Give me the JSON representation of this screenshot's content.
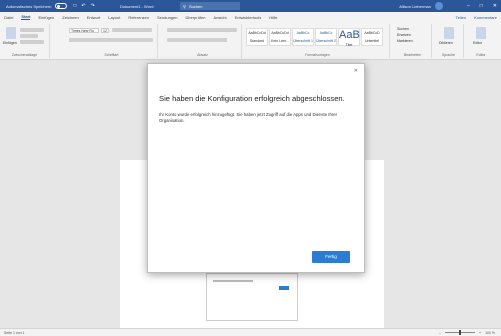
{
  "titlebar": {
    "autosave_label": "Automatisches Speichern",
    "autosave_state": "Aus",
    "doc_title": "Dokument1 - Word",
    "search_placeholder": "Suchen",
    "user_name": "Allison Lieberman"
  },
  "ribbon": {
    "tabs": [
      "Datei",
      "Start",
      "Einfügen",
      "Zeichnen",
      "Entwurf",
      "Layout",
      "Referenzen",
      "Sendungen",
      "Überprüfen",
      "Ansicht",
      "Entwicklertools",
      "Hilfe"
    ],
    "active_tab": "Start",
    "share_label": "Teilen",
    "comments_label": "Kommentare",
    "groups": {
      "clipboard": "Zwischenablage",
      "font": "Schriftart",
      "paragraph": "Absatz",
      "styles": "Formatvorlagen",
      "editing": "Bearbeiten",
      "voice": "Sprache",
      "editor": "Editor"
    },
    "paste_label": "Einfügen",
    "font_name": "Times New Ro",
    "font_size": "12",
    "styles": [
      {
        "sample": "AaBbCcDd",
        "name": "Standard"
      },
      {
        "sample": "AaBbCcDd",
        "name": "Kein Leer..."
      },
      {
        "sample": "AaBbCc",
        "name": "Überschrift 1"
      },
      {
        "sample": "AaBbCc",
        "name": "Überschrift 2"
      },
      {
        "sample": "AaB",
        "name": "Titel"
      },
      {
        "sample": "AaBbCcD",
        "name": "Untertitel"
      }
    ],
    "editing_items": [
      "Suchen",
      "Ersetzen",
      "Markieren"
    ],
    "voice_label": "Diktieren",
    "editor_label": "Editor"
  },
  "dialog": {
    "title": "Sie haben die Konfiguration erfolgreich abgeschlossen.",
    "body": "Ihr Konto wurde erfolgreich hinzugefügt. Sie haben jetzt Zugriff auf die Apps und Dienste Ihrer Organisation.",
    "done_label": "Fertig"
  },
  "statusbar": {
    "page_info": "Seite 1 von 1",
    "zoom": "100 %"
  },
  "colors": {
    "accent": "#2b579a",
    "button": "#2b7cd3"
  }
}
